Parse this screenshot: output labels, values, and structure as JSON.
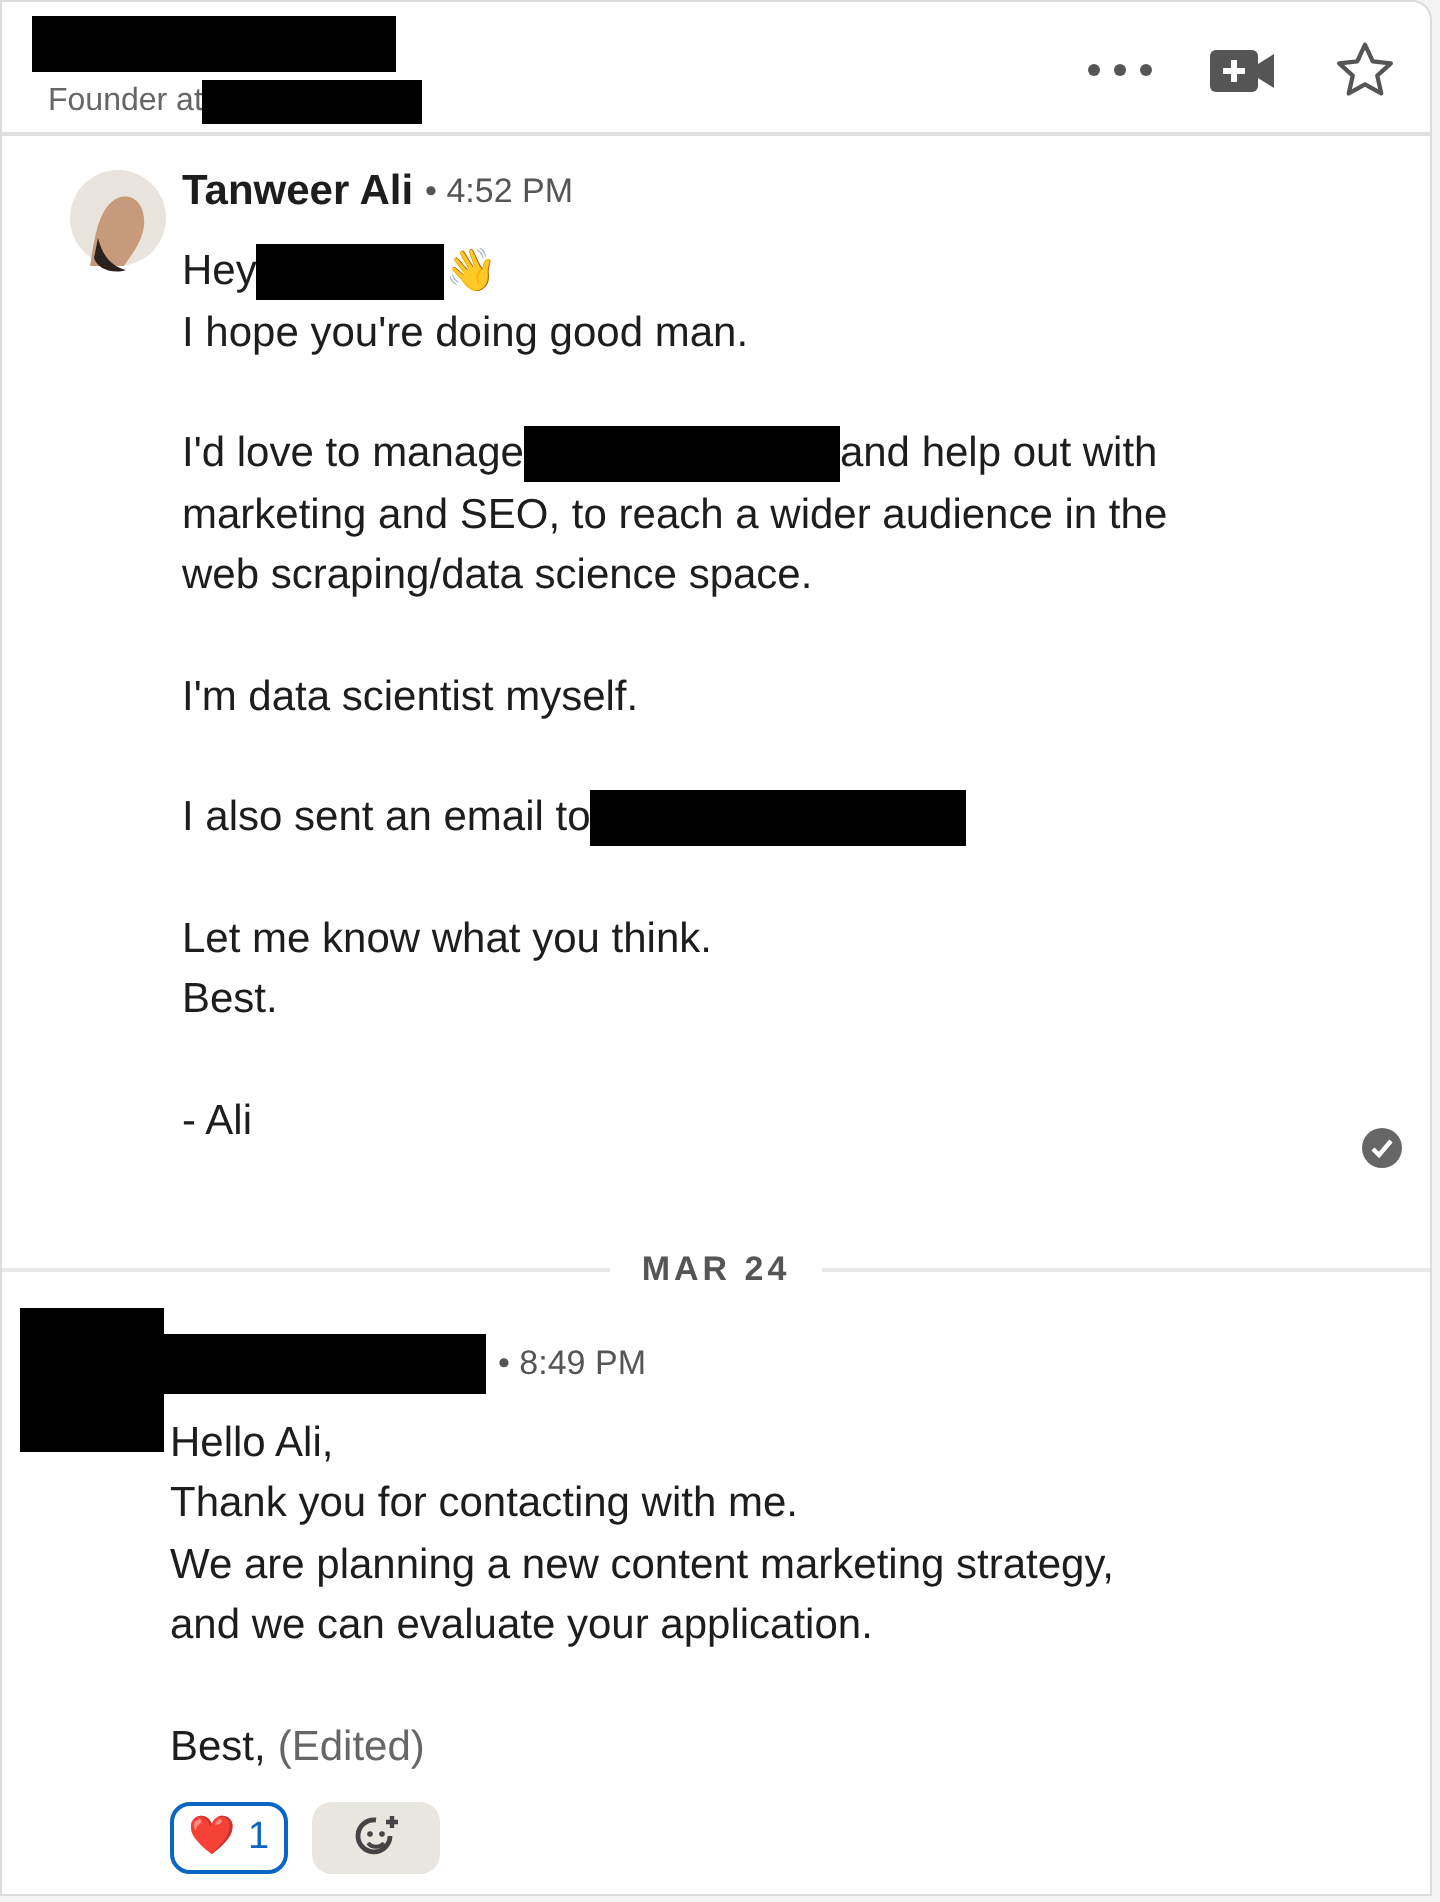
{
  "header": {
    "subtitle": "Founder at"
  },
  "messages": [
    {
      "kind": "photo",
      "name": "Tanweer Ali",
      "time": "• 4:52 PM",
      "read": true,
      "paragraphs": [
        [
          [
            {
              "kind": "text",
              "text": "Hey"
            },
            {
              "kind": "redaction"
            },
            {
              "kind": "text",
              "text": "👋"
            }
          ],
          [
            {
              "kind": "text",
              "text": "I hope you're doing good man."
            }
          ]
        ],
        [
          [
            {
              "kind": "text",
              "text": "I'd love to manage"
            },
            {
              "kind": "redaction"
            },
            {
              "kind": "text",
              "text": "and help out with"
            }
          ],
          [
            {
              "kind": "text",
              "text": "marketing and SEO, to reach a wider audience in the"
            }
          ],
          [
            {
              "kind": "text",
              "text": "web scraping/data science space."
            }
          ]
        ],
        [
          [
            {
              "kind": "text",
              "text": "I'm data scientist myself."
            }
          ]
        ],
        [
          [
            {
              "kind": "text",
              "text": "I also sent an email to"
            },
            {
              "kind": "redaction"
            }
          ]
        ],
        [
          [
            {
              "kind": "text",
              "text": "Let me know what you think."
            }
          ],
          [
            {
              "kind": "text",
              "text": "Best."
            }
          ]
        ],
        [
          [
            {
              "kind": "text",
              "text": "- Ali"
            }
          ]
        ]
      ]
    },
    {
      "kind": "redacted",
      "time": "• 8:49 PM",
      "date": "MAR 24",
      "read": false,
      "paragraphs": [
        [
          [
            {
              "kind": "text",
              "text": "Hello Ali,"
            }
          ],
          [
            {
              "kind": "text",
              "text": "Thank you for contacting with me."
            }
          ],
          [
            {
              "kind": "text",
              "text": "We are planning a new content marketing strategy,"
            }
          ],
          [
            {
              "kind": "text",
              "text": "and we can evaluate your application."
            }
          ]
        ],
        [
          [
            {
              "kind": "text",
              "text": "Best,"
            },
            {
              "kind": "edited",
              "text": "(Edited)"
            }
          ]
        ]
      ],
      "reactions": [
        {
          "emoji": "❤️",
          "count": "1",
          "selected": true
        }
      ]
    }
  ]
}
